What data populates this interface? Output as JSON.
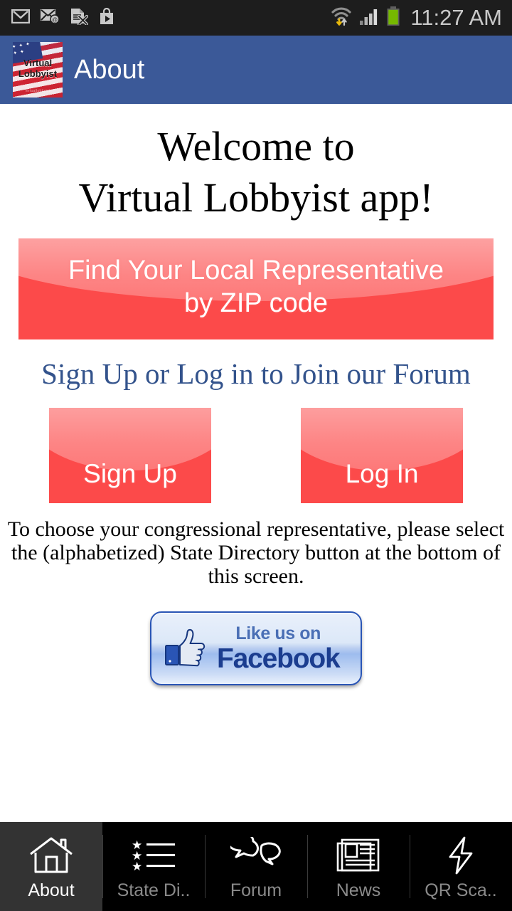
{
  "status_bar": {
    "time": "11:27 AM",
    "left_icons": [
      {
        "name": "gmail-icon"
      },
      {
        "name": "email-at-icon"
      },
      {
        "name": "document-error-icon"
      },
      {
        "name": "play-store-icon"
      }
    ],
    "right_icons": [
      {
        "name": "wifi-transfer-icon"
      },
      {
        "name": "cellular-signal-icon"
      },
      {
        "name": "battery-icon"
      }
    ]
  },
  "action_bar": {
    "title": "About",
    "logo": {
      "name": "virtual-lobbyist-logo",
      "line1": "Virtual",
      "line2": "Lobbyist",
      "subtitle": "virtuallobbyist"
    },
    "background_color": "#3B5998"
  },
  "main": {
    "welcome_line1": "Welcome to",
    "welcome_line2": "Virtual Lobbyist app!",
    "zip_banner": {
      "line1": "Find Your Local Representative",
      "line2": "by ZIP code",
      "color": "#FC4A4A"
    },
    "forum_prompt": "Sign Up or Log in to Join our Forum",
    "forum_prompt_color": "#33538C",
    "sign_up_label": "Sign Up",
    "log_in_label": "Log In",
    "instructions": "To choose your congressional representative, please select the (alphabetized) State Directory button at the bottom of this screen.",
    "facebook": {
      "line1": "Like us on",
      "line2": "Facebook",
      "icon": "thumbs-up-icon"
    }
  },
  "tabbar": {
    "background_color": "#000000",
    "active_color": "#333333",
    "items": [
      {
        "label": "About",
        "icon": "house-icon",
        "active": true
      },
      {
        "label": "State Di..",
        "icon": "star-list-icon",
        "active": false
      },
      {
        "label": "Forum",
        "icon": "speech-bubbles-icon",
        "active": false
      },
      {
        "label": "News",
        "icon": "newspaper-icon",
        "active": false
      },
      {
        "label": "QR Sca..",
        "icon": "lightning-bolt-icon",
        "active": false
      }
    ]
  }
}
